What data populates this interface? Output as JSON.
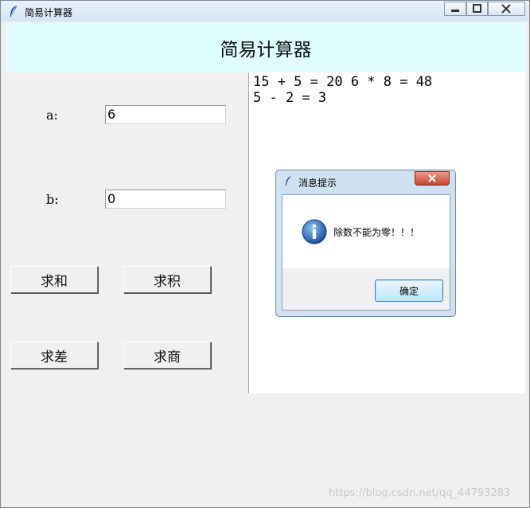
{
  "window": {
    "title": "简易计算器"
  },
  "header": {
    "title": "简易计算器"
  },
  "form": {
    "a_label": "a:",
    "a_value": "6",
    "b_label": "b:",
    "b_value": "0"
  },
  "buttons": {
    "sum": "求和",
    "product": "求积",
    "difference": "求差",
    "quotient": "求商"
  },
  "output": {
    "lines": [
      "15 + 5 = 20 6 * 8 = 48",
      "5 - 2 = 3"
    ]
  },
  "dialog": {
    "title": "消息提示",
    "message": "除数不能为零！！！",
    "ok_label": "确定",
    "icon": "info-icon"
  },
  "watermark": "https://blog.csdn.net/qq_44793283",
  "colors": {
    "header_bg": "#e0fdff",
    "window_bg": "#f0f0f0",
    "close_red": "#c54731"
  }
}
